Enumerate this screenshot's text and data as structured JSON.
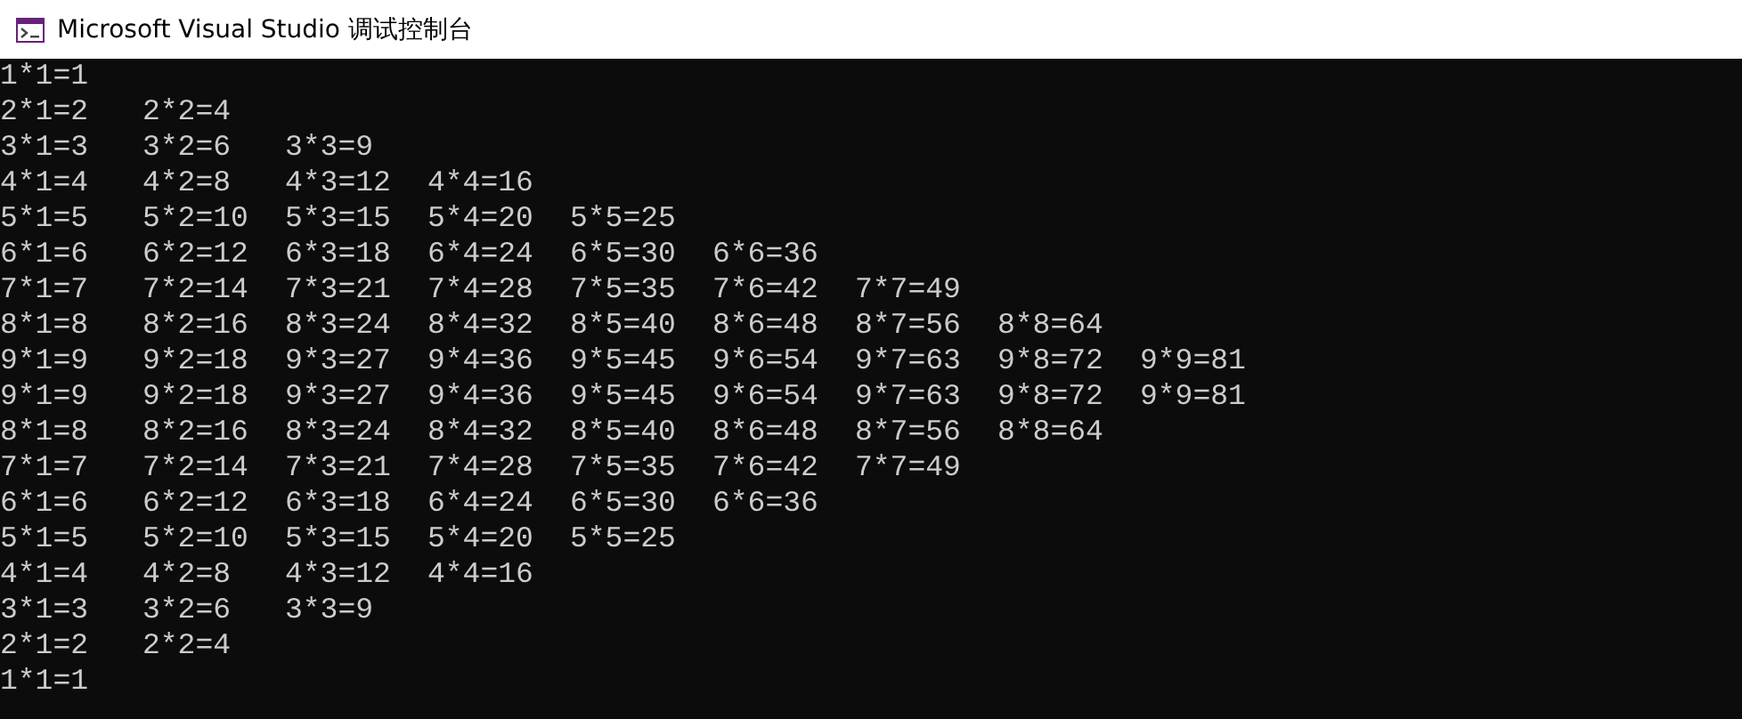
{
  "window": {
    "title": "Microsoft Visual Studio 调试控制台"
  },
  "console": {
    "lines": [
      [
        "1*1=1"
      ],
      [
        "2*1=2",
        "2*2=4"
      ],
      [
        "3*1=3",
        "3*2=6",
        "3*3=9"
      ],
      [
        "4*1=4",
        "4*2=8",
        "4*3=12",
        "4*4=16"
      ],
      [
        "5*1=5",
        "5*2=10",
        "5*3=15",
        "5*4=20",
        "5*5=25"
      ],
      [
        "6*1=6",
        "6*2=12",
        "6*3=18",
        "6*4=24",
        "6*5=30",
        "6*6=36"
      ],
      [
        "7*1=7",
        "7*2=14",
        "7*3=21",
        "7*4=28",
        "7*5=35",
        "7*6=42",
        "7*7=49"
      ],
      [
        "8*1=8",
        "8*2=16",
        "8*3=24",
        "8*4=32",
        "8*5=40",
        "8*6=48",
        "8*7=56",
        "8*8=64"
      ],
      [
        "9*1=9",
        "9*2=18",
        "9*3=27",
        "9*4=36",
        "9*5=45",
        "9*6=54",
        "9*7=63",
        "9*8=72",
        "9*9=81"
      ],
      [
        "9*1=9",
        "9*2=18",
        "9*3=27",
        "9*4=36",
        "9*5=45",
        "9*6=54",
        "9*7=63",
        "9*8=72",
        "9*9=81"
      ],
      [
        "8*1=8",
        "8*2=16",
        "8*3=24",
        "8*4=32",
        "8*5=40",
        "8*6=48",
        "8*7=56",
        "8*8=64"
      ],
      [
        "7*1=7",
        "7*2=14",
        "7*3=21",
        "7*4=28",
        "7*5=35",
        "7*6=42",
        "7*7=49"
      ],
      [
        "6*1=6",
        "6*2=12",
        "6*3=18",
        "6*4=24",
        "6*5=30",
        "6*6=36"
      ],
      [
        "5*1=5",
        "5*2=10",
        "5*3=15",
        "5*4=20",
        "5*5=25"
      ],
      [
        "4*1=4",
        "4*2=8",
        "4*3=12",
        "4*4=16"
      ],
      [
        "3*1=3",
        "3*2=6",
        "3*3=9"
      ],
      [
        "2*1=2",
        "2*2=4"
      ],
      [
        "1*1=1"
      ]
    ]
  }
}
